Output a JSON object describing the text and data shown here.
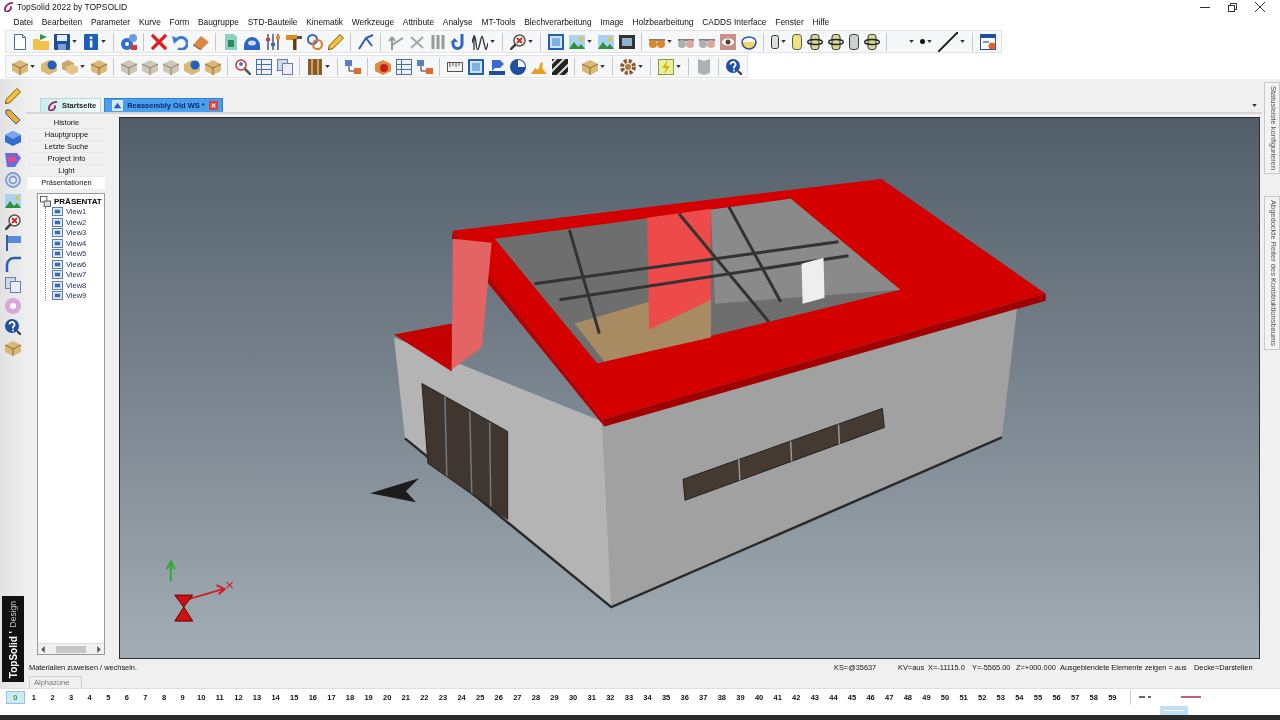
{
  "window": {
    "title": "TopSolid 2022 by TOPSOLID"
  },
  "menu": [
    "Datei",
    "Bearbeiten",
    "Parameter",
    "Kurve",
    "Form",
    "Baugruppe",
    "STD-Bauteile",
    "Kinematik",
    "Werkzeuge",
    "Attribute",
    "Analyse",
    "MT-Tools",
    "Blechverarbeitung",
    "Image",
    "Holzbearbeitung",
    "CADDS Interface",
    "Fenster",
    "Hilfe"
  ],
  "brand": {
    "product": "TopSolid '",
    "module": "Design"
  },
  "document_tabs": [
    {
      "label": "Startseite",
      "selected": false
    },
    {
      "label": "Reassembly Old WS *",
      "selected": true
    }
  ],
  "panel_sections": [
    {
      "label": "Historie",
      "selected": false
    },
    {
      "label": "Hauptgruppe",
      "selected": false
    },
    {
      "label": "Letzte Suche",
      "selected": false
    },
    {
      "label": "Project Info",
      "selected": false
    },
    {
      "label": "Light",
      "selected": false
    },
    {
      "label": "Präsentationen",
      "selected": true
    }
  ],
  "tree": [
    {
      "label": "PRÄSENTAT",
      "children": [
        {
          "label": "View1"
        },
        {
          "label": "View2"
        },
        {
          "label": "View3"
        },
        {
          "label": "View4"
        },
        {
          "label": "View5"
        },
        {
          "label": "View6"
        },
        {
          "label": "View7"
        },
        {
          "label": "View8"
        },
        {
          "label": "View9"
        }
      ]
    }
  ],
  "side_tabs": [
    "Statusleiste konfigurieren",
    "Abgedockte Reiter des Konstruktionsbaums"
  ],
  "status_bar": {
    "message": "Materialien zuweisen / wechseln.",
    "fields": [
      "KS=@35637",
      "KV=aus",
      "X=-11115.0",
      "Y=-5565.00",
      "Z=+000.000",
      "Ausgeblendete Elemente zeigen = aus",
      "Decke=Darstellen"
    ]
  },
  "zone_tab": {
    "label": "Alphazone"
  },
  "layers": [
    {
      "label": "0",
      "selected": true
    },
    {
      "label": "1",
      "selected": false
    },
    {
      "label": "2",
      "selected": false
    },
    {
      "label": "3",
      "selected": false
    },
    {
      "label": "4",
      "selected": false
    },
    {
      "label": "5",
      "selected": false
    },
    {
      "label": "6",
      "selected": false
    },
    {
      "label": "7",
      "selected": false
    },
    {
      "label": "8",
      "selected": false
    },
    {
      "label": "9",
      "selected": false
    },
    {
      "label": "10",
      "selected": false
    },
    {
      "label": "11",
      "selected": false
    },
    {
      "label": "12",
      "selected": false
    },
    {
      "label": "13",
      "selected": false
    },
    {
      "label": "14",
      "selected": false
    },
    {
      "label": "15",
      "selected": false
    },
    {
      "label": "16",
      "selected": false
    },
    {
      "label": "17",
      "selected": false
    },
    {
      "label": "18",
      "selected": false
    },
    {
      "label": "19",
      "selected": false
    },
    {
      "label": "20",
      "selected": false
    },
    {
      "label": "21",
      "selected": false
    },
    {
      "label": "22",
      "selected": false
    },
    {
      "label": "23",
      "selected": false
    },
    {
      "label": "24",
      "selected": false
    },
    {
      "label": "25",
      "selected": false
    },
    {
      "label": "26",
      "selected": false
    },
    {
      "label": "27",
      "selected": false
    },
    {
      "label": "28",
      "selected": false
    },
    {
      "label": "29",
      "selected": false
    },
    {
      "label": "30",
      "selected": false
    },
    {
      "label": "31",
      "selected": false
    },
    {
      "label": "32",
      "selected": false
    },
    {
      "label": "33",
      "selected": false
    },
    {
      "label": "34",
      "selected": false
    },
    {
      "label": "35",
      "selected": false
    },
    {
      "label": "36",
      "selected": false
    },
    {
      "label": "37",
      "selected": false
    },
    {
      "label": "38",
      "selected": false
    },
    {
      "label": "39",
      "selected": false
    },
    {
      "label": "40",
      "selected": false
    },
    {
      "label": "41",
      "selected": false
    },
    {
      "label": "42",
      "selected": false
    },
    {
      "label": "43",
      "selected": false
    },
    {
      "label": "44",
      "selected": false
    },
    {
      "label": "45",
      "selected": false
    },
    {
      "label": "46",
      "selected": false
    },
    {
      "label": "47",
      "selected": false
    },
    {
      "label": "48",
      "selected": false
    },
    {
      "label": "49",
      "selected": false
    },
    {
      "label": "50",
      "selected": false
    },
    {
      "label": "51",
      "selected": false
    },
    {
      "label": "52",
      "selected": false
    },
    {
      "label": "53",
      "selected": false
    },
    {
      "label": "54",
      "selected": false
    },
    {
      "label": "55",
      "selected": false
    },
    {
      "label": "56",
      "selected": false
    },
    {
      "label": "57",
      "selected": false
    },
    {
      "label": "58",
      "selected": false
    },
    {
      "label": "59",
      "selected": false
    }
  ]
}
